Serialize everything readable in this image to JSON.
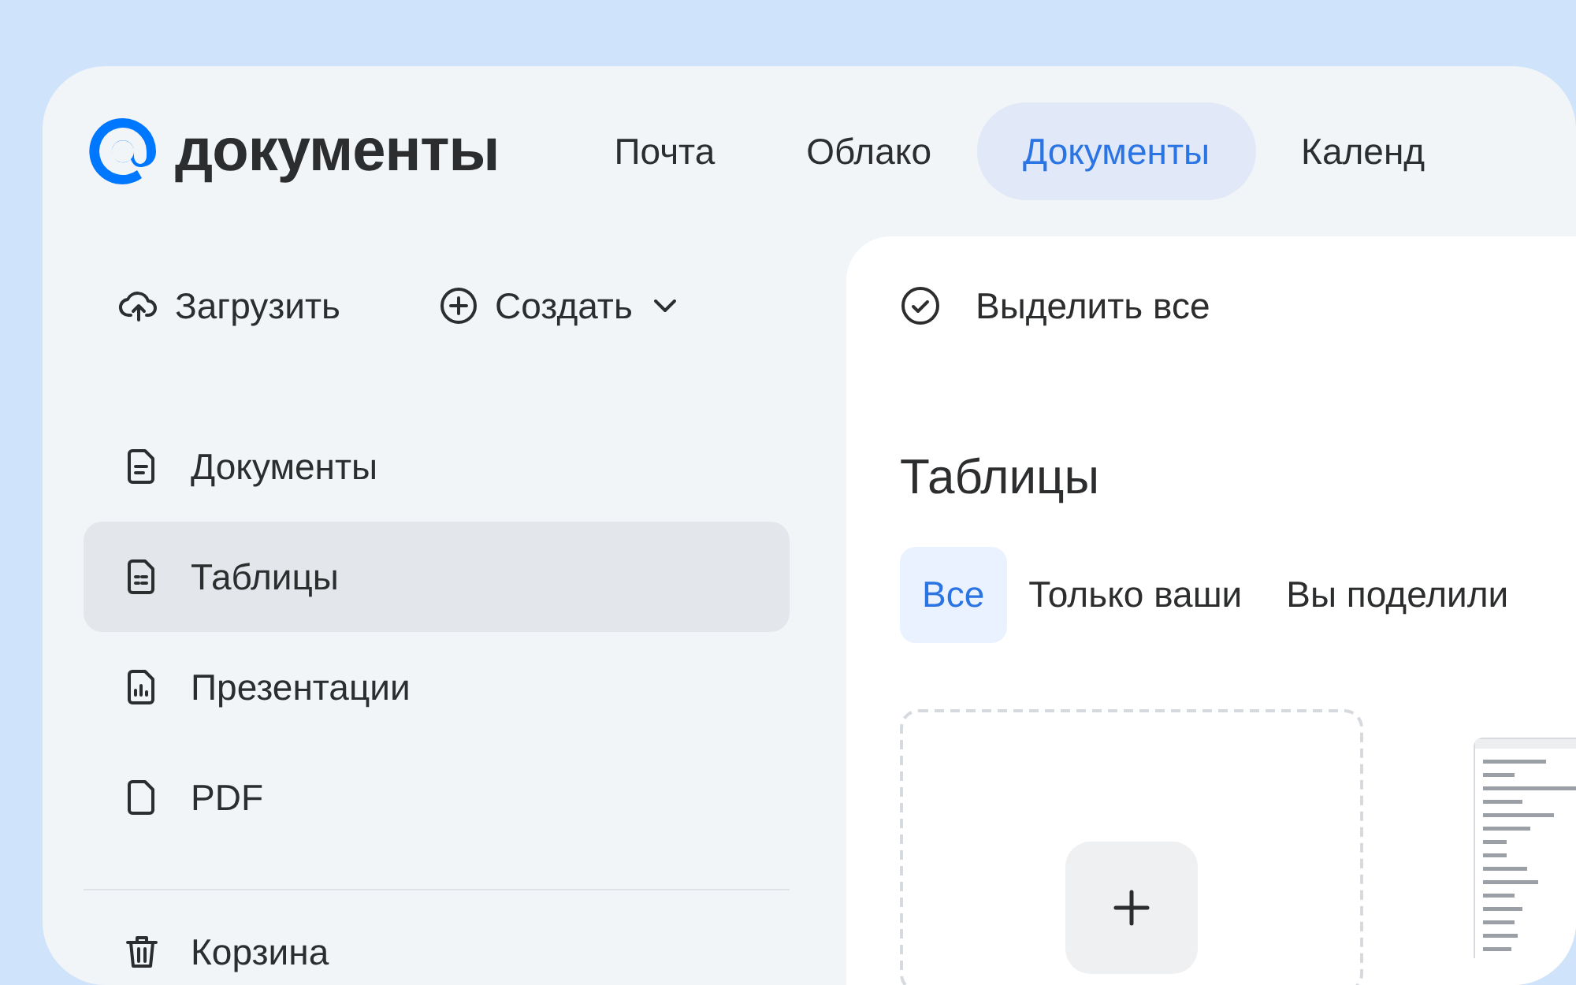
{
  "logo": {
    "text": "документы"
  },
  "nav": [
    {
      "label": "Почта",
      "selected": false
    },
    {
      "label": "Облако",
      "selected": false
    },
    {
      "label": "Документы",
      "selected": true
    },
    {
      "label": "Календ",
      "selected": false
    }
  ],
  "actions": [
    {
      "label": "Загрузить",
      "kind": "upload"
    },
    {
      "label": "Создать",
      "kind": "create"
    }
  ],
  "sidebar": {
    "items": [
      {
        "label": "Документы",
        "kind": "doc",
        "selected": false
      },
      {
        "label": "Таблицы",
        "kind": "sheet",
        "selected": true
      },
      {
        "label": "Презентации",
        "kind": "slides",
        "selected": false
      },
      {
        "label": "PDF",
        "kind": "pdf",
        "selected": false
      }
    ],
    "trash": {
      "label": "Корзина"
    }
  },
  "select_all": {
    "label": "Выделить все"
  },
  "heading": "Таблицы",
  "filters": [
    {
      "label": "Все",
      "selected": true
    },
    {
      "label": "Только ваши",
      "selected": false
    },
    {
      "label": "Вы поделили",
      "selected": false
    }
  ],
  "files": [
    {
      "kind": "new"
    },
    {
      "kind": "picture"
    }
  ]
}
